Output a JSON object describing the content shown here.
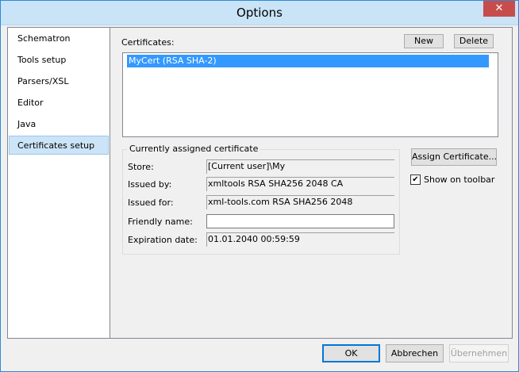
{
  "window": {
    "title": "Options",
    "close_glyph": "✕"
  },
  "sidebar": {
    "items": [
      {
        "label": "Schematron"
      },
      {
        "label": "Tools setup"
      },
      {
        "label": "Parsers/XSL"
      },
      {
        "label": "Editor"
      },
      {
        "label": "Java"
      },
      {
        "label": "Certificates setup",
        "selected": true
      }
    ]
  },
  "certificates": {
    "label": "Certificates:",
    "new_label": "New",
    "delete_label": "Delete",
    "items": [
      {
        "label": "MyCert (RSA SHA-2)",
        "selected": true
      }
    ]
  },
  "assigned": {
    "group_title": "Currently assigned certificate",
    "store_label": "Store:",
    "store_value": "[Current user]\\My",
    "issued_by_label": "Issued by:",
    "issued_by_value": "xmltools RSA SHA256 2048 CA",
    "issued_for_label": "Issued for:",
    "issued_for_value": "xml-tools.com RSA SHA256 2048",
    "friendly_name_label": "Friendly name:",
    "friendly_name_value": "",
    "expiration_label": "Expiration date:",
    "expiration_value": "01.01.2040 00:59:59"
  },
  "assign_button_label": "Assign Certificate...",
  "show_on_toolbar": {
    "label": "Show on toolbar",
    "checked": true,
    "check_glyph": "✔"
  },
  "footer": {
    "ok_label": "OK",
    "cancel_label": "Abbrechen",
    "apply_label": "Übernehmen"
  },
  "colors": {
    "titlebar": "#c9e3f7",
    "selection": "#3399ff",
    "close": "#c74d4d"
  }
}
